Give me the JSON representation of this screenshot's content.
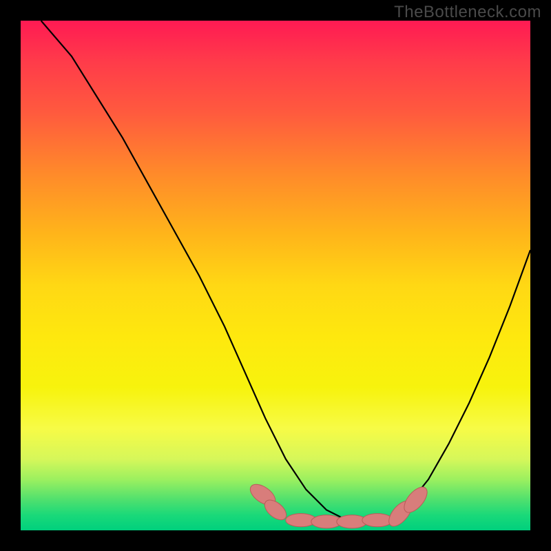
{
  "watermark": "TheBottleneck.com",
  "colors": {
    "background": "#000000",
    "curve": "#000000",
    "marker_fill": "#d87d7b",
    "marker_stroke": "#b85c58",
    "gradient_top": "#ff1a53",
    "gradient_bottom": "#00d07d"
  },
  "chart_data": {
    "type": "line",
    "title": "",
    "xlabel": "",
    "ylabel": "",
    "xlim": [
      0,
      100
    ],
    "ylim": [
      0,
      100
    ],
    "description": "V-shaped bottleneck curve over performance-color gradient background. Curve descends steeply from upper-left, flattens near zero around x≈55–70, then rises on the right. Pink oblong markers highlight the near-bottom segment.",
    "series": [
      {
        "name": "bottleneck-curve",
        "x": [
          4,
          10,
          15,
          20,
          25,
          30,
          35,
          40,
          44,
          48,
          52,
          56,
          60,
          64,
          68,
          72,
          76,
          80,
          84,
          88,
          92,
          96,
          100
        ],
        "y": [
          100,
          93,
          85,
          77,
          68,
          59,
          50,
          40,
          31,
          22,
          14,
          8,
          4,
          2,
          1.5,
          2,
          5,
          10,
          17,
          25,
          34,
          44,
          55
        ]
      }
    ],
    "markers": [
      {
        "cx": 47.5,
        "cy": 7.0,
        "rx": 1.5,
        "ry": 2.8,
        "rot": -55
      },
      {
        "cx": 50.0,
        "cy": 4.0,
        "rx": 1.4,
        "ry": 2.5,
        "rot": -50
      },
      {
        "cx": 55.0,
        "cy": 2.0,
        "rx": 3.0,
        "ry": 1.3,
        "rot": 0
      },
      {
        "cx": 60.0,
        "cy": 1.7,
        "rx": 3.0,
        "ry": 1.3,
        "rot": 0
      },
      {
        "cx": 65.0,
        "cy": 1.7,
        "rx": 3.0,
        "ry": 1.3,
        "rot": 0
      },
      {
        "cx": 70.0,
        "cy": 2.0,
        "rx": 3.0,
        "ry": 1.3,
        "rot": 0
      },
      {
        "cx": 74.5,
        "cy": 3.3,
        "rx": 1.5,
        "ry": 3.0,
        "rot": 40
      },
      {
        "cx": 77.5,
        "cy": 6.0,
        "rx": 1.5,
        "ry": 3.0,
        "rot": 40
      }
    ]
  }
}
